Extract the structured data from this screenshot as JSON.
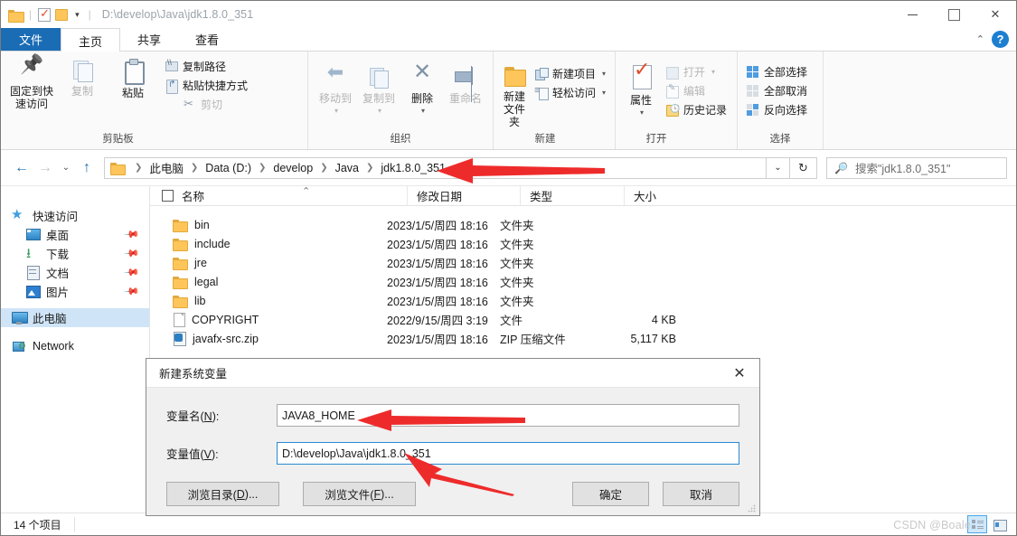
{
  "window": {
    "title_path": "D:\\develop\\Java\\jdk1.8.0_351",
    "minimize": "—",
    "maximize": "□",
    "close": "✕",
    "qat_chevron": "▾"
  },
  "tabs": [
    {
      "label": "文件",
      "kind": "file"
    },
    {
      "label": "主页",
      "kind": "active"
    },
    {
      "label": "共享",
      "kind": "normal"
    },
    {
      "label": "查看",
      "kind": "normal"
    }
  ],
  "tabstrip_right": {
    "collapse": "⌃",
    "help": "?"
  },
  "ribbon": {
    "groups": [
      {
        "label": "剪贴板",
        "big": [
          {
            "label": "固定到快\n速访问",
            "icon": "pin-icon",
            "dim": false
          },
          {
            "label": "复制",
            "icon": "copy-icon",
            "dim": true
          },
          {
            "label": "粘贴",
            "icon": "paste-icon",
            "dim": false
          }
        ],
        "small": [
          {
            "label": "复制路径",
            "icon": "copy-path-icon",
            "dim": false
          },
          {
            "label": "粘贴快捷方式",
            "icon": "paste-shortcut-icon",
            "dim": false
          },
          {
            "label": "剪切",
            "icon": "cut-icon",
            "dim": true
          }
        ]
      },
      {
        "label": "组织",
        "big": [
          {
            "label": "移动到",
            "icon": "move-to-icon",
            "dim": true,
            "caret": true
          },
          {
            "label": "复制到",
            "icon": "copy-to-icon",
            "dim": true,
            "caret": true
          },
          {
            "label": "删除",
            "icon": "delete-icon",
            "dim": false,
            "caret": true
          },
          {
            "label": "重命名",
            "icon": "rename-icon",
            "dim": true
          }
        ]
      },
      {
        "label": "新建",
        "big": [
          {
            "label": "新建\n文件夹",
            "icon": "new-folder-icon",
            "dim": false
          }
        ],
        "small": [
          {
            "label": "新建项目",
            "icon": "new-item-icon",
            "caret": true
          },
          {
            "label": "轻松访问",
            "icon": "easy-access-icon",
            "caret": true
          }
        ]
      },
      {
        "label": "打开",
        "big": [
          {
            "label": "属性",
            "icon": "properties-icon",
            "dim": false,
            "caret": true
          }
        ],
        "small": [
          {
            "label": "打开",
            "icon": "open-icon",
            "dim": true,
            "caret": true
          },
          {
            "label": "编辑",
            "icon": "edit-icon",
            "dim": true
          },
          {
            "label": "历史记录",
            "icon": "history-icon",
            "dim": false
          }
        ]
      },
      {
        "label": "选择",
        "small": [
          {
            "label": "全部选择",
            "icon": "select-all-icon"
          },
          {
            "label": "全部取消",
            "icon": "select-none-icon"
          },
          {
            "label": "反向选择",
            "icon": "invert-selection-icon"
          }
        ]
      }
    ]
  },
  "addressbar": {
    "back": "←",
    "forward": "→",
    "recent": "⌄",
    "up": "↑",
    "crumbs": [
      "此电脑",
      "Data (D:)",
      "develop",
      "Java",
      "jdk1.8.0_351"
    ],
    "crumb_dropdown": "⌄",
    "refresh": "↻",
    "search_placeholder": "搜索\"jdk1.8.0_351\"",
    "search_value": ""
  },
  "nav": {
    "quick_access": "快速访问",
    "items": [
      {
        "label": "桌面",
        "icon": "desktop-icon",
        "pinned": true
      },
      {
        "label": "下载",
        "icon": "download-icon",
        "pinned": true
      },
      {
        "label": "文档",
        "icon": "documents-icon",
        "pinned": true
      },
      {
        "label": "图片",
        "icon": "pictures-icon",
        "pinned": true
      }
    ],
    "this_pc": "此电脑",
    "network": "Network"
  },
  "filelist": {
    "columns": [
      "名称",
      "修改日期",
      "类型",
      "大小"
    ],
    "sort_indicator": "⌃",
    "rows": [
      {
        "name": "bin",
        "date": "2023/1/5/周四 18:16",
        "type": "文件夹",
        "size": "",
        "icon": "folder-icon"
      },
      {
        "name": "include",
        "date": "2023/1/5/周四 18:16",
        "type": "文件夹",
        "size": "",
        "icon": "folder-icon"
      },
      {
        "name": "jre",
        "date": "2023/1/5/周四 18:16",
        "type": "文件夹",
        "size": "",
        "icon": "folder-icon"
      },
      {
        "name": "legal",
        "date": "2023/1/5/周四 18:16",
        "type": "文件夹",
        "size": "",
        "icon": "folder-icon"
      },
      {
        "name": "lib",
        "date": "2023/1/5/周四 18:16",
        "type": "文件夹",
        "size": "",
        "icon": "folder-icon"
      },
      {
        "name": "COPYRIGHT",
        "date": "2022/9/15/周四 3:19",
        "type": "文件",
        "size": "4 KB",
        "icon": "file-icon"
      },
      {
        "name": "javafx-src.zip",
        "date": "2023/1/5/周四 18:16",
        "type": "ZIP 压缩文件",
        "size": "5,117 KB",
        "icon": "zip-icon"
      }
    ]
  },
  "statusbar": {
    "item_count": "14 个项目",
    "watermark": "CSDN @Boale"
  },
  "dialog": {
    "title": "新建系统变量",
    "close": "✕",
    "fields": [
      {
        "label_pre": "变量名(",
        "label_key": "N",
        "label_post": "):",
        "value": "JAVA8_HOME",
        "focused": false
      },
      {
        "label_pre": "变量值(",
        "label_key": "V",
        "label_post": "):",
        "value": "D:\\develop\\Java\\jdk1.8.0_351",
        "focused": true
      }
    ],
    "buttons": {
      "browse_dir_pre": "浏览目录(",
      "browse_dir_key": "D",
      "browse_dir_post": ")...",
      "browse_file_pre": "浏览文件(",
      "browse_file_key": "F",
      "browse_file_post": ")...",
      "ok": "确定",
      "cancel": "取消"
    }
  },
  "annotations": {
    "accent_color": "#ee2b2b",
    "arrows": [
      {
        "name": "breadcrumb-arrow"
      },
      {
        "name": "variable-name-arrow"
      },
      {
        "name": "variable-value-arrow"
      }
    ]
  }
}
